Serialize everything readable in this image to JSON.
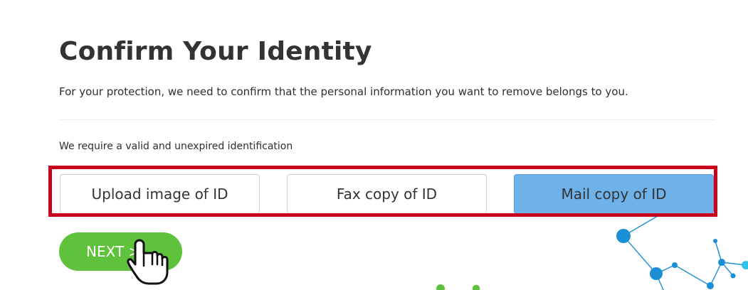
{
  "page": {
    "title": "Confirm Your Identity",
    "intro": "For your protection, we need to confirm that the personal information you want to remove belongs to you.",
    "requirement": "We require a valid and unexpired identification"
  },
  "id_options": [
    {
      "label": "Upload image of ID",
      "selected": false
    },
    {
      "label": "Fax copy of ID",
      "selected": false
    },
    {
      "label": "Mail copy of ID",
      "selected": true
    }
  ],
  "next_button": {
    "label": "NEXT >"
  },
  "colors": {
    "selected_option": "#6fb2ea",
    "next_button": "#5fc23c",
    "highlight_frame": "#c8001e",
    "network_nodes": "#1b8fd6"
  },
  "icons": {
    "cursor": "hand-pointer-icon",
    "decoration": "network-graph-icon"
  }
}
